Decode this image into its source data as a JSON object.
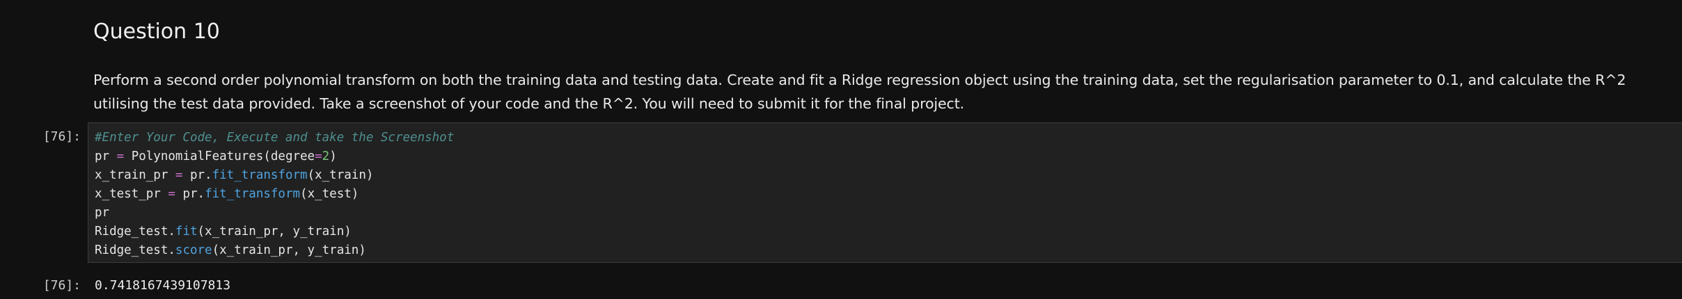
{
  "markdown": {
    "heading": "Question 10",
    "paragraph": "Perform a second order polynomial transform on both the training data and testing data. Create and fit a Ridge regression object using the training data, set the regularisation parameter to 0.1, and calculate the R^2 utilising the test data provided. Take a screenshot of your code and the R^2. You will need to submit it for the final project."
  },
  "code_cell": {
    "in_prompt": "[76]:",
    "lines": [
      [
        {
          "t": "#Enter Your Code, Execute and take the Screenshot",
          "c": "comment"
        }
      ],
      [
        {
          "t": "pr ",
          "c": ""
        },
        {
          "t": "=",
          "c": "op"
        },
        {
          "t": " PolynomialFeatures(degree",
          "c": ""
        },
        {
          "t": "=",
          "c": "op"
        },
        {
          "t": "2",
          "c": "num"
        },
        {
          "t": ")",
          "c": ""
        }
      ],
      [
        {
          "t": "x_train_pr ",
          "c": ""
        },
        {
          "t": "=",
          "c": "op"
        },
        {
          "t": " pr.",
          "c": ""
        },
        {
          "t": "fit_transform",
          "c": "method"
        },
        {
          "t": "(x_train)",
          "c": ""
        }
      ],
      [
        {
          "t": "x_test_pr ",
          "c": ""
        },
        {
          "t": "=",
          "c": "op"
        },
        {
          "t": " pr.",
          "c": ""
        },
        {
          "t": "fit_transform",
          "c": "method"
        },
        {
          "t": "(x_test)",
          "c": ""
        }
      ],
      [
        {
          "t": "pr",
          "c": ""
        }
      ],
      [
        {
          "t": "Ridge_test.",
          "c": ""
        },
        {
          "t": "fit",
          "c": "method"
        },
        {
          "t": "(x_train_pr, y_train)",
          "c": ""
        }
      ],
      [
        {
          "t": "Ridge_test.",
          "c": ""
        },
        {
          "t": "score",
          "c": "method"
        },
        {
          "t": "(x_train_pr, y_train)",
          "c": ""
        }
      ]
    ]
  },
  "output_cell": {
    "out_prompt": "[76]:",
    "value": "0.7418167439107813"
  },
  "colors": {
    "background": "#111111",
    "code_background": "#212121",
    "comment": "#4f8f8f",
    "operator": "#c76ec7",
    "number": "#7cc47c",
    "method": "#4fa3e0"
  }
}
